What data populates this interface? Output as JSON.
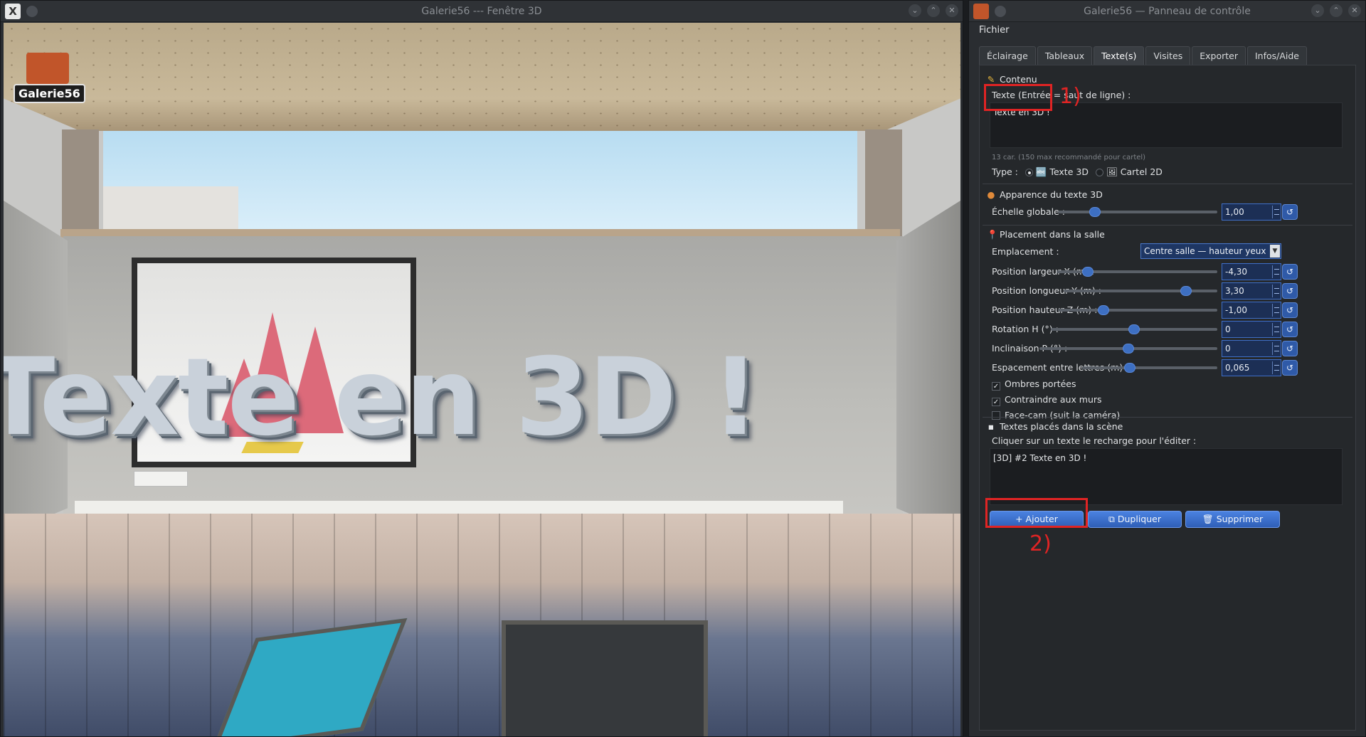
{
  "window3d": {
    "title": "Galerie56 --- Fenêtre 3D",
    "logo_text": "Galerie56",
    "scene_text": "Texte en 3D !"
  },
  "panel": {
    "title": "Galerie56 — Panneau de contrôle",
    "menu": {
      "file": "Fichier"
    },
    "tabs": [
      "Éclairage",
      "Tableaux",
      "Texte(s)",
      "Visites",
      "Exporter",
      "Infos/Aide"
    ],
    "active_tab": "Texte(s)",
    "contenu": {
      "title": "Contenu",
      "text_label": "Texte (Entrée = saut de ligne) :",
      "text_value": "Texte en 3D !",
      "char_count": "13 car. (150 max recommandé pour cartel)",
      "type_label": "Type :",
      "type_option_3d": "🔤 Texte 3D",
      "type_option_2d": "🖼 Cartel 2D",
      "type_selected": "Texte 3D"
    },
    "apparence": {
      "title": "Apparence du texte 3D",
      "scale_label": "Échelle globale :",
      "scale_value": "1,00",
      "scale_level": 0.21
    },
    "placement": {
      "title": "Placement dans la salle",
      "location_label": "Emplacement :",
      "location_value": "Centre salle — hauteur yeux",
      "rows": [
        {
          "label": "Position largeur X (m) :",
          "value": "-4,30",
          "level": 0.17
        },
        {
          "label": "Position longueur Y (m) :",
          "value": "3,30",
          "level": 0.82
        },
        {
          "label": "Position hauteur Z (m) :",
          "value": "-1,00",
          "level": 0.27
        },
        {
          "label": "Rotation H (°) :",
          "value": "0",
          "level": 0.5
        },
        {
          "label": "Inclinaison P (°) :",
          "value": "0",
          "level": 0.5
        },
        {
          "label": "Espacement entre lettres (m) :",
          "value": "0,065",
          "level": 0.34
        }
      ],
      "checks": [
        {
          "label": "Ombres portées",
          "checked": true,
          "mark": "✓"
        },
        {
          "label": "Contraindre aux murs",
          "checked": true,
          "mark": "✓"
        },
        {
          "label": "Face-cam (suit la caméra)",
          "checked": false,
          "mark": ""
        }
      ]
    },
    "textes": {
      "title": "Textes placés dans la scène",
      "hint": "Cliquer sur un texte le recharge pour l'éditer :",
      "items": [
        "[3D] #2  Texte en 3D !"
      ],
      "add_button": "+ Ajouter",
      "duplicate_button": "⧉ Dupliquer",
      "delete_button": "🗑 Supprimer"
    },
    "annotations": {
      "one": "1)",
      "two": "2)"
    }
  },
  "colors": {
    "accent": "#2f5fb8",
    "annotation": "#e02424"
  }
}
